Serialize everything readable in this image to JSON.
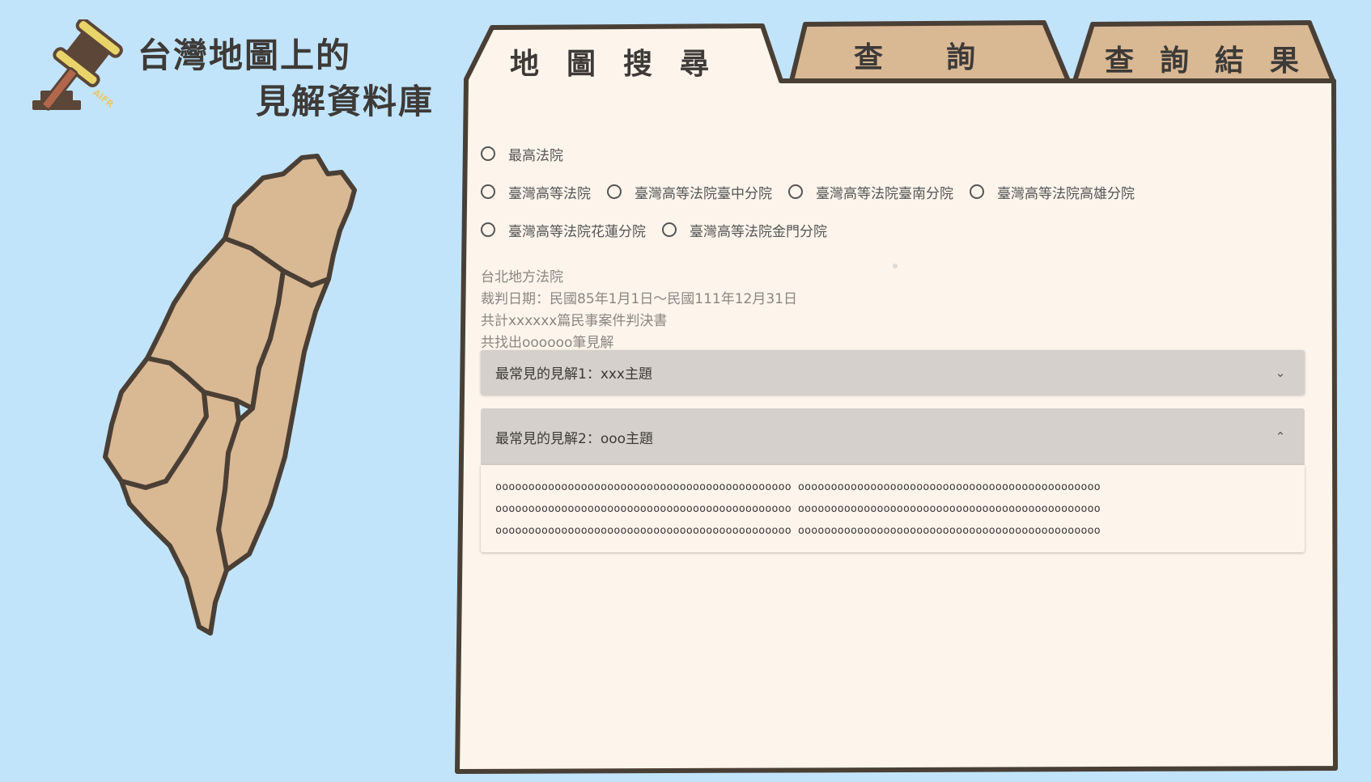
{
  "app": {
    "title_line1": "台灣地圖上的",
    "title_line2": "見解資料庫",
    "logo_text": "AIFR"
  },
  "tabs": [
    {
      "label": "地圖搜尋",
      "active": true
    },
    {
      "label": "查詢",
      "active": false
    },
    {
      "label": "查詢結果",
      "active": false
    }
  ],
  "courts": {
    "row1": [
      "最高法院"
    ],
    "row2": [
      "臺灣高等法院",
      "臺灣高等法院臺中分院",
      "臺灣高等法院臺南分院",
      "臺灣高等法院高雄分院"
    ],
    "row3": [
      "臺灣高等法院花蓮分院",
      "臺灣高等法院金門分院"
    ]
  },
  "info": {
    "court": "台北地方法院",
    "date_range": "裁判日期：民國85年1月1日～民國111年12月31日",
    "total_cases": "共計xxxxxx篇民事案件判決書",
    "found_opinions": "共找出oooooo筆見解"
  },
  "accordion": [
    {
      "title": "最常見的見解1：xxx主題",
      "expanded": false,
      "chevron": "chevron-down-icon"
    },
    {
      "title": "最常見的見解2：ooo主題",
      "expanded": true,
      "chevron": "chevron-up-icon",
      "body": [
        "ooooooooooooooooooooooooooooooooooooooooooooo oooooooooooooooooooooooooooooooooooooooooooooo",
        "ooooooooooooooooooooooooooooooooooooooooooooo oooooooooooooooooooooooooooooooooooooooooooooo",
        "ooooooooooooooooooooooooooooooooooooooooooooo oooooooooooooooooooooooooooooooooooooooooooooo"
      ]
    }
  ],
  "colors": {
    "background": "#c1e4fb",
    "panel": "#fdf5ec",
    "tab_inactive": "#d9b894",
    "map_fill": "#d9b894",
    "outline": "#4a3f35"
  }
}
